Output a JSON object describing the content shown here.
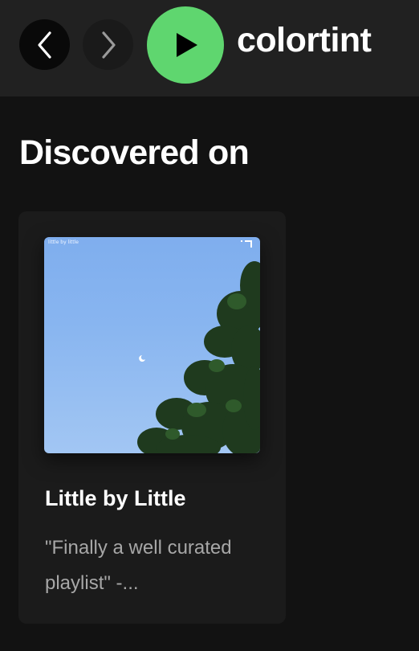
{
  "header": {
    "back_icon": "chevron-left-icon",
    "forward_icon": "chevron-right-icon",
    "play_icon": "play-icon",
    "play_color": "#5fd66f",
    "artist_name": "colortint"
  },
  "section": {
    "title": "Discovered on"
  },
  "card": {
    "cover_caption": "little by little",
    "title": "Little by Little",
    "description": "\"Finally a well curated playlist\" -..."
  }
}
